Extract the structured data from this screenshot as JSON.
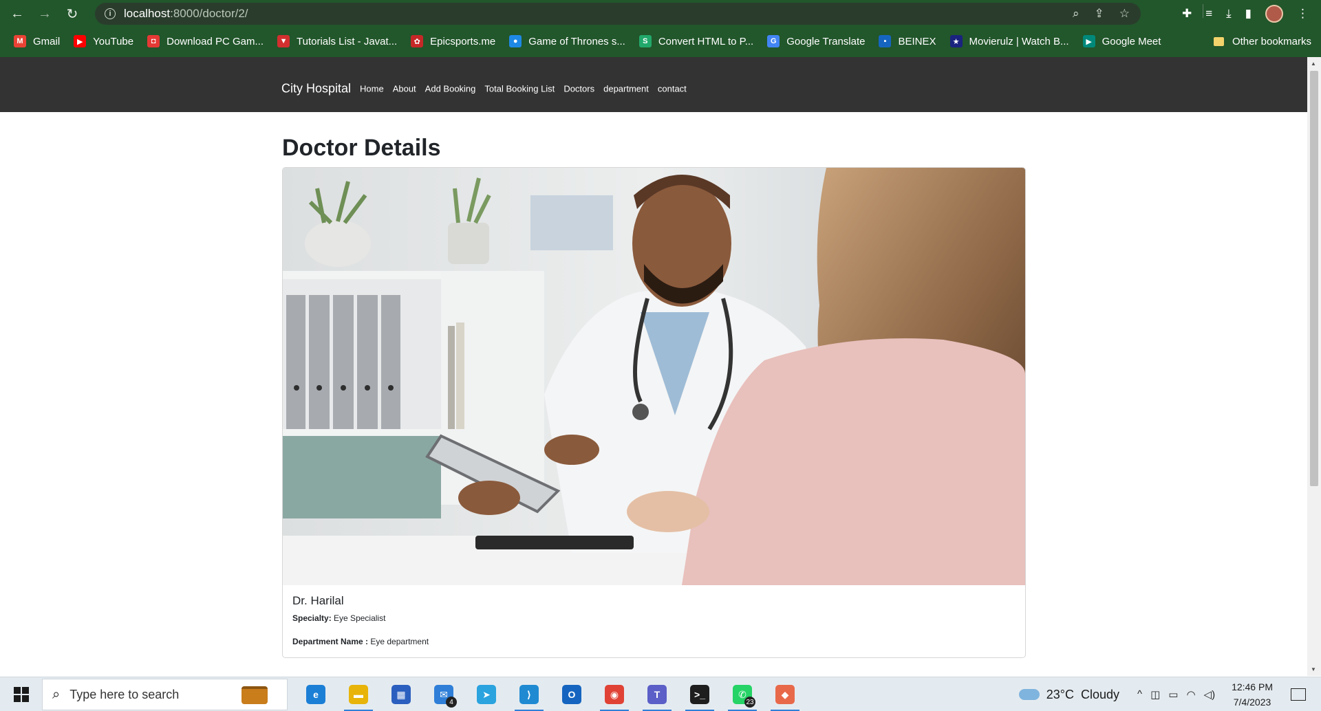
{
  "browser": {
    "url_host": "localhost",
    "url_path": ":8000/doctor/2/",
    "bookmarks": [
      {
        "label": "Gmail",
        "icon": "gmail-icon",
        "color": "#ea4335",
        "glyph": "M"
      },
      {
        "label": "YouTube",
        "icon": "youtube-icon",
        "color": "#ff0000",
        "glyph": "▶"
      },
      {
        "label": "Download PC Gam...",
        "icon": "game-icon",
        "color": "#e53935",
        "glyph": "◘"
      },
      {
        "label": "Tutorials List - Javat...",
        "icon": "javatpoint-icon",
        "color": "#d32f2f",
        "glyph": "▼"
      },
      {
        "label": "Epicsports.me",
        "icon": "epicsports-icon",
        "color": "#c62828",
        "glyph": "✿"
      },
      {
        "label": "Game of Thrones s...",
        "icon": "globe-icon",
        "color": "#1e88e5",
        "glyph": "●"
      },
      {
        "label": "Convert HTML to P...",
        "icon": "convert-icon",
        "color": "#22a86b",
        "glyph": "S"
      },
      {
        "label": "Google Translate",
        "icon": "translate-icon",
        "color": "#4285f4",
        "glyph": "G"
      },
      {
        "label": "BEINEX",
        "icon": "beinex-icon",
        "color": "#1565c0",
        "glyph": "▪"
      },
      {
        "label": "Movierulz | Watch B...",
        "icon": "movierulz-icon",
        "color": "#1a237e",
        "glyph": "★"
      },
      {
        "label": "Google Meet",
        "icon": "meet-icon",
        "color": "#00897b",
        "glyph": "▶"
      }
    ],
    "other_bookmarks": "Other bookmarks"
  },
  "site": {
    "brand": "City Hospital",
    "nav": [
      "Home",
      "About",
      "Add Booking",
      "Total Booking List",
      "Doctors",
      "department",
      "contact"
    ]
  },
  "doctor": {
    "page_title": "Doctor Details",
    "name": "Dr. Harilal",
    "specialty_label": "Specialty:",
    "specialty": "Eye Specialist",
    "department_label": "Department Name :",
    "department": "Eye department"
  },
  "taskbar": {
    "search_placeholder": "Type here to search",
    "weather_temp": "23°C",
    "weather_desc": "Cloudy",
    "time": "12:46 PM",
    "date": "7/4/2023",
    "apps": [
      {
        "name": "edge-app",
        "color": "#1c7fd6",
        "glyph": "e",
        "badge": ""
      },
      {
        "name": "file-explorer-app",
        "color": "#e8b40a",
        "glyph": "▬",
        "badge": ""
      },
      {
        "name": "store-app",
        "color": "#2b5fbf",
        "glyph": "▦",
        "badge": ""
      },
      {
        "name": "mail-app",
        "color": "#2f7fd8",
        "glyph": "✉",
        "badge": "4"
      },
      {
        "name": "telegram-app",
        "color": "#2aa3de",
        "glyph": "➤",
        "badge": ""
      },
      {
        "name": "vscode-app",
        "color": "#1f8ad2",
        "glyph": "⟩",
        "badge": ""
      },
      {
        "name": "outlook-app",
        "color": "#1565c0",
        "glyph": "O",
        "badge": ""
      },
      {
        "name": "chrome-app",
        "color": "#e04336",
        "glyph": "◉",
        "badge": ""
      },
      {
        "name": "teams-app",
        "color": "#5b5fc7",
        "glyph": "T",
        "badge": ""
      },
      {
        "name": "terminal-app",
        "color": "#1e1e1e",
        "glyph": ">_",
        "badge": ""
      },
      {
        "name": "whatsapp-app",
        "color": "#25d366",
        "glyph": "✆",
        "badge": "23"
      },
      {
        "name": "git-app",
        "color": "#e8694a",
        "glyph": "◆",
        "badge": ""
      }
    ]
  }
}
